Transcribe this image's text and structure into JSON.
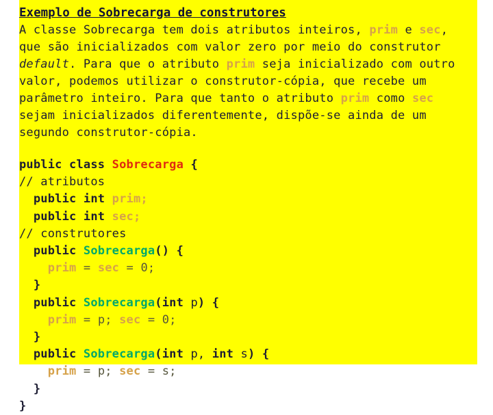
{
  "slide": {
    "background_color": "#ffff00",
    "page_background_color": "#ffffff",
    "title": "Exemplo de Sobrecarga de construtores",
    "colors": {
      "body_text": "#242438",
      "highlight_field": "#d6a24a",
      "class_decl": "#e02a10",
      "constructor_name": "#00a86b",
      "operator": "#55553b"
    },
    "paragraph": {
      "line1_a": "A classe Sobrecarga tem dois atributos inteiros, ",
      "line1_prim": "prim",
      "line1_b": " e ",
      "line1_sec": "sec",
      "line1_c": ",",
      "line2": "que são inicializados com valor zero por meio do construtor",
      "line3_default": "default",
      "line3_a": ". Para que o atributo ",
      "line3_prim": "prim",
      "line3_b": " seja inicializado com outro",
      "line4": "valor, podemos utilizar o construtor-cópia, que recebe um",
      "line5_a": "parâmetro inteiro. Para que tanto o atributo ",
      "line5_prim": "prim",
      "line5_b": " como ",
      "line5_sec": "sec",
      "line6": "sejam inicializados diferentemente, dispõe-se ainda de um",
      "line7": "segundo construtor-cópia."
    },
    "code": {
      "l1_kw": "public class ",
      "l1_cls": "Sobrecarga",
      "l1_brace": " {",
      "l2_comment": "// atributos",
      "l3_indent": "  ",
      "l3_kw": "public int ",
      "l3_field": "prim",
      "l3_semi": ";",
      "l4_indent": "  ",
      "l4_kw": "public int ",
      "l4_field": "sec",
      "l4_semi": ";",
      "l5_comment": "// construtores",
      "l6_indent": "  ",
      "l6_kw": "public ",
      "l6_cls": "Sobrecarga",
      "l6_rest": "() {",
      "l7_indent": "    ",
      "l7_field1": "prim",
      "l7_op1": " = ",
      "l7_field2": "sec",
      "l7_op2": " = ",
      "l7_val": "0;",
      "l8": "  }",
      "l9_indent": "  ",
      "l9_kw": "public ",
      "l9_cls": "Sobrecarga",
      "l9_paren": "(",
      "l9_int": "int",
      "l9_param": " p",
      "l9_rest": ") {",
      "l10_indent": "    ",
      "l10_field1": "prim",
      "l10_op1": " = ",
      "l10_val1": "p;",
      "l10_gap": " ",
      "l10_field2": "sec",
      "l10_op2": " = ",
      "l10_val2": "0;",
      "l11": "  }",
      "l12_indent": "  ",
      "l12_kw": "public ",
      "l12_cls": "Sobrecarga",
      "l12_paren": "(",
      "l12_int1": "int",
      "l12_param1": " p, ",
      "l12_int2": "int",
      "l12_param2": " s",
      "l12_rest": ") {",
      "l13_indent": "    ",
      "l13_field1": "prim",
      "l13_op1": " = ",
      "l13_val1": "p;",
      "l13_gap": " ",
      "l13_field2": "sec",
      "l13_op2": " = ",
      "l13_val2": "s;",
      "l14": "  }",
      "l15": "}"
    }
  }
}
